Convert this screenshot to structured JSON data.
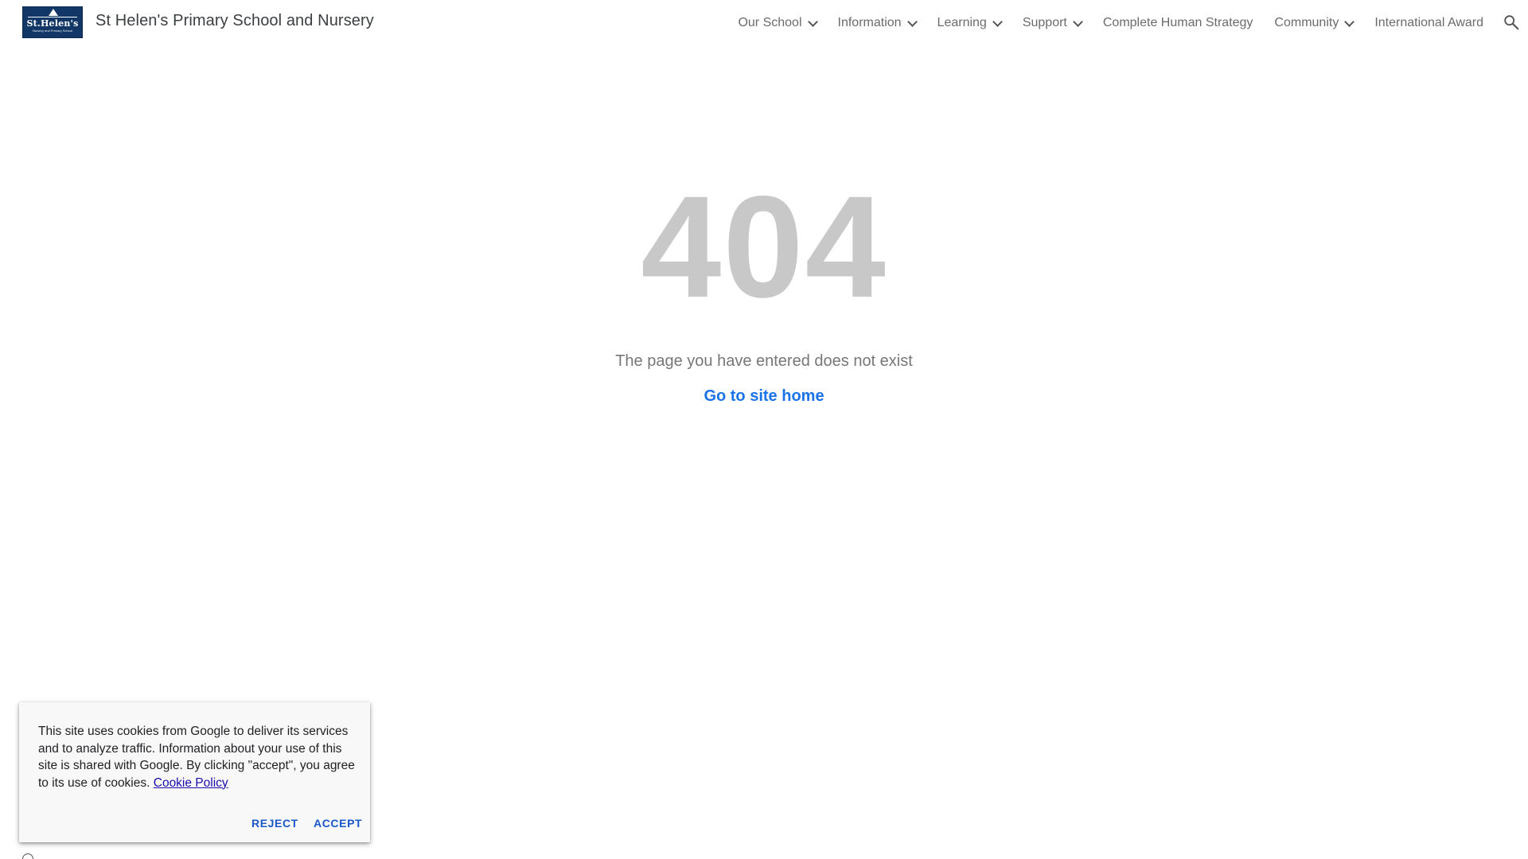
{
  "header": {
    "logo_text": "St.Helen's",
    "logo_subtext": "Nursery and Primary School",
    "site_title": "St Helen's Primary School and Nursery",
    "nav": [
      {
        "label": "Our School",
        "has_dropdown": true
      },
      {
        "label": "Information",
        "has_dropdown": true
      },
      {
        "label": "Learning",
        "has_dropdown": true
      },
      {
        "label": "Support",
        "has_dropdown": true
      },
      {
        "label": "Complete Human Strategy",
        "has_dropdown": false
      },
      {
        "label": "Community",
        "has_dropdown": true
      },
      {
        "label": "International Award",
        "has_dropdown": false
      }
    ],
    "search_icon": "search-icon"
  },
  "main": {
    "error_code": "404",
    "message": "The page you have entered does not exist",
    "home_link": "Go to site home"
  },
  "cookie_banner": {
    "text": "This site uses cookies from Google to deliver its services and to analyze traffic. Information about your use of this site is shared with Google. By clicking \"accept\", you agree to its use of cookies.",
    "policy_link": "Cookie Policy",
    "reject_label": "REJECT",
    "accept_label": "ACCEPT"
  },
  "colors": {
    "logo_bg": "#123766",
    "error_code": "#c8c8c8",
    "link_blue": "#1a73e8",
    "button_blue": "#1a57c9"
  }
}
